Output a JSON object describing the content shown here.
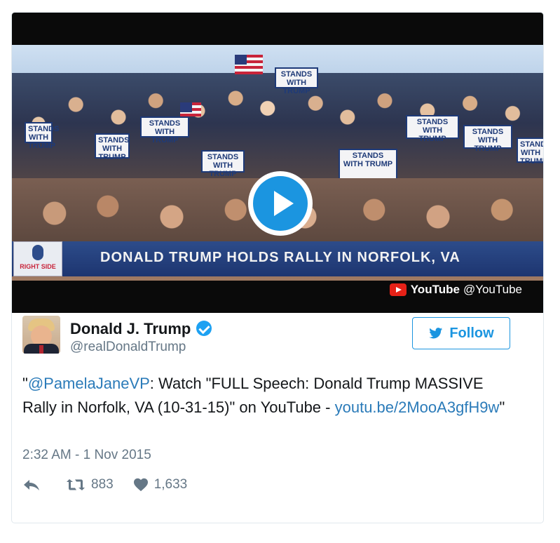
{
  "video": {
    "headline": "DONALD TRUMP HOLDS RALLY IN NORFOLK, VA",
    "channel_logo_text": "RIGHT SIDE",
    "provider_brand": "YouTube",
    "provider_handle": "@YouTube",
    "sign_text": "STANDS WITH TRUMP"
  },
  "author": {
    "name": "Donald J. Trump",
    "handle": "@realDonaldTrump",
    "verified": true,
    "avatar_icon": "profile-photo"
  },
  "follow": {
    "label": "Follow",
    "color": "#1b95e0"
  },
  "tweet": {
    "quote_open": "\"",
    "mention": "@PamelaJaneVP",
    "body": ": Watch \"FULL Speech: Donald Trump MASSIVE Rally in Norfolk, VA (10-31-15)\" on YouTube - ",
    "url": "youtu.be/2MooA3gfH9w",
    "quote_close": "\"",
    "timestamp": "2:32 AM - 1 Nov 2015"
  },
  "actions": {
    "reply_icon": "reply-icon",
    "retweet_icon": "retweet-icon",
    "like_icon": "heart-icon",
    "retweets": "883",
    "likes": "1,633"
  },
  "colors": {
    "link": "#2b7bb9",
    "muted": "#657786",
    "verified": "#1da1f2",
    "play": "#1b95e0"
  }
}
